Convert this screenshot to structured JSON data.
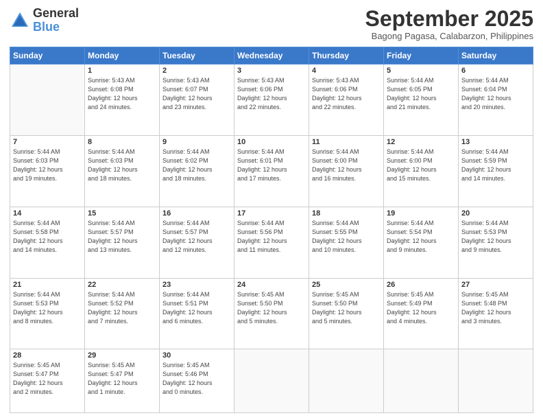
{
  "logo": {
    "line1": "General",
    "line2": "Blue"
  },
  "title": "September 2025",
  "subtitle": "Bagong Pagasa, Calabarzon, Philippines",
  "weekdays": [
    "Sunday",
    "Monday",
    "Tuesday",
    "Wednesday",
    "Thursday",
    "Friday",
    "Saturday"
  ],
  "weeks": [
    [
      {
        "day": "",
        "info": ""
      },
      {
        "day": "1",
        "info": "Sunrise: 5:43 AM\nSunset: 6:08 PM\nDaylight: 12 hours\nand 24 minutes."
      },
      {
        "day": "2",
        "info": "Sunrise: 5:43 AM\nSunset: 6:07 PM\nDaylight: 12 hours\nand 23 minutes."
      },
      {
        "day": "3",
        "info": "Sunrise: 5:43 AM\nSunset: 6:06 PM\nDaylight: 12 hours\nand 22 minutes."
      },
      {
        "day": "4",
        "info": "Sunrise: 5:43 AM\nSunset: 6:06 PM\nDaylight: 12 hours\nand 22 minutes."
      },
      {
        "day": "5",
        "info": "Sunrise: 5:44 AM\nSunset: 6:05 PM\nDaylight: 12 hours\nand 21 minutes."
      },
      {
        "day": "6",
        "info": "Sunrise: 5:44 AM\nSunset: 6:04 PM\nDaylight: 12 hours\nand 20 minutes."
      }
    ],
    [
      {
        "day": "7",
        "info": "Sunrise: 5:44 AM\nSunset: 6:03 PM\nDaylight: 12 hours\nand 19 minutes."
      },
      {
        "day": "8",
        "info": "Sunrise: 5:44 AM\nSunset: 6:03 PM\nDaylight: 12 hours\nand 18 minutes."
      },
      {
        "day": "9",
        "info": "Sunrise: 5:44 AM\nSunset: 6:02 PM\nDaylight: 12 hours\nand 18 minutes."
      },
      {
        "day": "10",
        "info": "Sunrise: 5:44 AM\nSunset: 6:01 PM\nDaylight: 12 hours\nand 17 minutes."
      },
      {
        "day": "11",
        "info": "Sunrise: 5:44 AM\nSunset: 6:00 PM\nDaylight: 12 hours\nand 16 minutes."
      },
      {
        "day": "12",
        "info": "Sunrise: 5:44 AM\nSunset: 6:00 PM\nDaylight: 12 hours\nand 15 minutes."
      },
      {
        "day": "13",
        "info": "Sunrise: 5:44 AM\nSunset: 5:59 PM\nDaylight: 12 hours\nand 14 minutes."
      }
    ],
    [
      {
        "day": "14",
        "info": "Sunrise: 5:44 AM\nSunset: 5:58 PM\nDaylight: 12 hours\nand 14 minutes."
      },
      {
        "day": "15",
        "info": "Sunrise: 5:44 AM\nSunset: 5:57 PM\nDaylight: 12 hours\nand 13 minutes."
      },
      {
        "day": "16",
        "info": "Sunrise: 5:44 AM\nSunset: 5:57 PM\nDaylight: 12 hours\nand 12 minutes."
      },
      {
        "day": "17",
        "info": "Sunrise: 5:44 AM\nSunset: 5:56 PM\nDaylight: 12 hours\nand 11 minutes."
      },
      {
        "day": "18",
        "info": "Sunrise: 5:44 AM\nSunset: 5:55 PM\nDaylight: 12 hours\nand 10 minutes."
      },
      {
        "day": "19",
        "info": "Sunrise: 5:44 AM\nSunset: 5:54 PM\nDaylight: 12 hours\nand 9 minutes."
      },
      {
        "day": "20",
        "info": "Sunrise: 5:44 AM\nSunset: 5:53 PM\nDaylight: 12 hours\nand 9 minutes."
      }
    ],
    [
      {
        "day": "21",
        "info": "Sunrise: 5:44 AM\nSunset: 5:53 PM\nDaylight: 12 hours\nand 8 minutes."
      },
      {
        "day": "22",
        "info": "Sunrise: 5:44 AM\nSunset: 5:52 PM\nDaylight: 12 hours\nand 7 minutes."
      },
      {
        "day": "23",
        "info": "Sunrise: 5:44 AM\nSunset: 5:51 PM\nDaylight: 12 hours\nand 6 minutes."
      },
      {
        "day": "24",
        "info": "Sunrise: 5:45 AM\nSunset: 5:50 PM\nDaylight: 12 hours\nand 5 minutes."
      },
      {
        "day": "25",
        "info": "Sunrise: 5:45 AM\nSunset: 5:50 PM\nDaylight: 12 hours\nand 5 minutes."
      },
      {
        "day": "26",
        "info": "Sunrise: 5:45 AM\nSunset: 5:49 PM\nDaylight: 12 hours\nand 4 minutes."
      },
      {
        "day": "27",
        "info": "Sunrise: 5:45 AM\nSunset: 5:48 PM\nDaylight: 12 hours\nand 3 minutes."
      }
    ],
    [
      {
        "day": "28",
        "info": "Sunrise: 5:45 AM\nSunset: 5:47 PM\nDaylight: 12 hours\nand 2 minutes."
      },
      {
        "day": "29",
        "info": "Sunrise: 5:45 AM\nSunset: 5:47 PM\nDaylight: 12 hours\nand 1 minute."
      },
      {
        "day": "30",
        "info": "Sunrise: 5:45 AM\nSunset: 5:46 PM\nDaylight: 12 hours\nand 0 minutes."
      },
      {
        "day": "",
        "info": ""
      },
      {
        "day": "",
        "info": ""
      },
      {
        "day": "",
        "info": ""
      },
      {
        "day": "",
        "info": ""
      }
    ]
  ]
}
